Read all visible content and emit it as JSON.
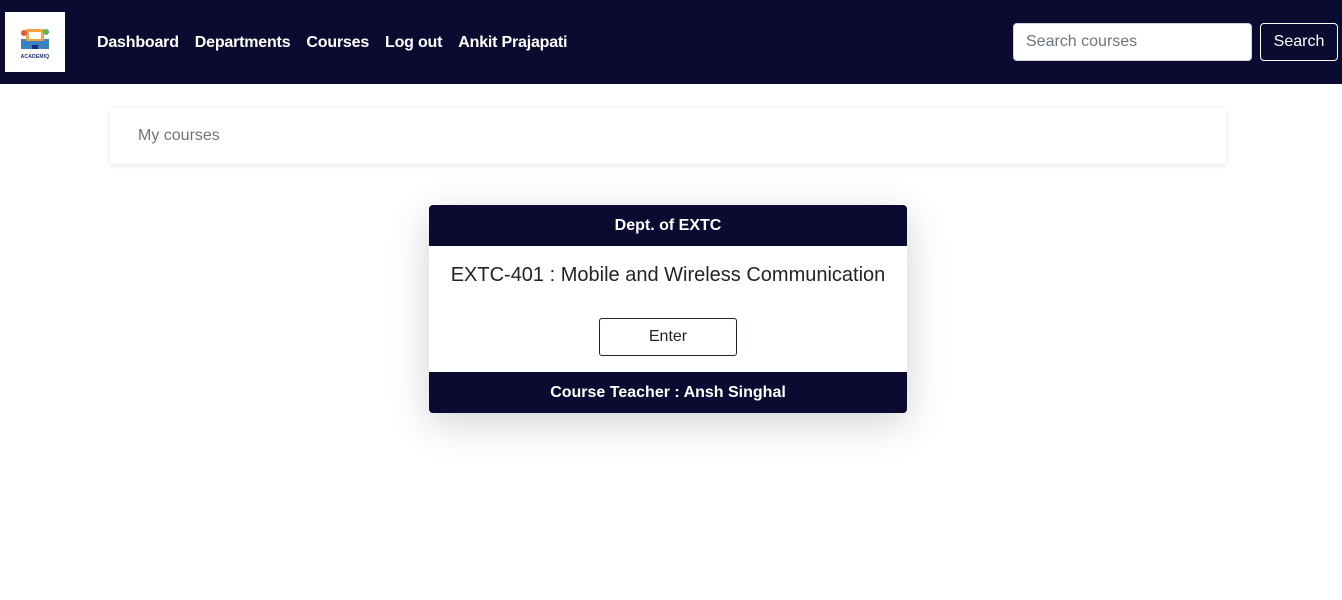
{
  "navbar": {
    "logo_text": "ACADEMIQ",
    "links": [
      {
        "label": "Dashboard"
      },
      {
        "label": "Departments"
      },
      {
        "label": "Courses"
      },
      {
        "label": "Log out"
      },
      {
        "label": "Ankit Prajapati"
      }
    ],
    "search": {
      "placeholder": "Search courses",
      "value": "",
      "button_label": "Search"
    },
    "background_color": "#0b0b32"
  },
  "breadcrumb": {
    "label": "My courses"
  },
  "course_card": {
    "department": "Dept. of EXTC",
    "title": "EXTC-401 : Mobile and Wireless Communication",
    "enter_label": "Enter",
    "teacher": "Course Teacher : Ansh Singhal"
  }
}
